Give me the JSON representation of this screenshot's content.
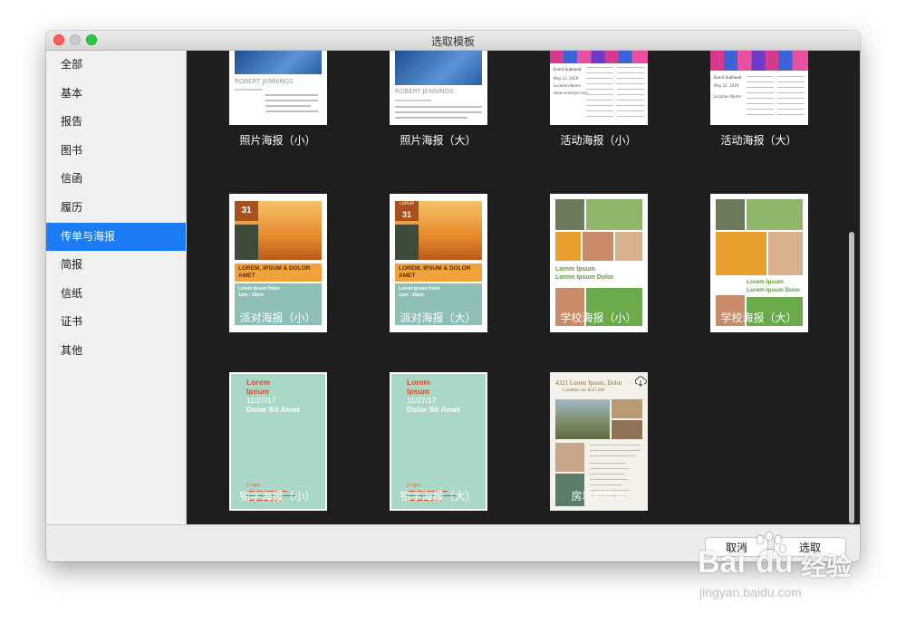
{
  "window": {
    "title": "选取模板"
  },
  "sidebar": {
    "items": [
      {
        "label": "全部"
      },
      {
        "label": "基本"
      },
      {
        "label": "报告"
      },
      {
        "label": "图书"
      },
      {
        "label": "信函"
      },
      {
        "label": "履历"
      },
      {
        "label": "传单与海报",
        "active": true
      },
      {
        "label": "简报"
      },
      {
        "label": "信纸"
      },
      {
        "label": "证书"
      },
      {
        "label": "其他"
      }
    ]
  },
  "templates": [
    {
      "label": "照片海报（小）",
      "text": {
        "name": "ROBERT JENNINGS"
      }
    },
    {
      "label": "照片海报（大）",
      "text": {
        "name": "ROBERT JENNINGS"
      }
    },
    {
      "label": "活动海报（小）",
      "text": {
        "heading": "Event Subhead",
        "date": "May 22, 2019",
        "loc": "Location Name",
        "site": "www.example.com"
      }
    },
    {
      "label": "活动海报（大）",
      "text": {
        "heading": "Event Subhead",
        "date": "May 22, 2019",
        "loc": "Location Name"
      }
    },
    {
      "label": "派对海报（小）",
      "text": {
        "num": "31",
        "main": "LOREM, IPSUM & DOLOR AMET",
        "sub": "Lorem Ipsum Dolor",
        "time": "1pm - 10pm"
      }
    },
    {
      "label": "派对海报（大）",
      "text": {
        "month": "LOREM",
        "num": "31",
        "main": "LOREM, IPSUM & DOLOR AMET",
        "sub": "Lorem Ipsum Dolor",
        "time": "1pm - 10pm"
      }
    },
    {
      "label": "学校海报（小）",
      "text": {
        "l1": "Lorem Ipsum",
        "l2": "Lorem Ipsum Dolor"
      }
    },
    {
      "label": "学校海报（大）",
      "text": {
        "l1": "Lorem Ipsum",
        "l2": "Lorem Ipsum Dolor"
      }
    },
    {
      "label": "铅字海报（小）",
      "text": {
        "l1": "Lorem",
        "l2": "Ipsum",
        "l3": "11/27/17",
        "l4": "Dolor Sit Amet",
        "l5": "5:15pm"
      }
    },
    {
      "label": "铅字海报（大）",
      "text": {
        "l1": "Lorem",
        "l2": "Ipsum",
        "l3": "11/27/17",
        "l4": "Dolor Sit Amet",
        "l5": "5:15pm"
      }
    },
    {
      "label": "房地产传单",
      "text": {
        "addr": "4321 Lorem Ipsum, Dolor",
        "price": "Curabitur leo $525,000"
      },
      "icon": "cloud-download-icon"
    }
  ],
  "buttons": {
    "cancel": "取消",
    "choose": "选取"
  },
  "watermark": {
    "brand": "Bai",
    "brand2": "du",
    "cn": "经验",
    "url": "jingyan.baidu.com"
  },
  "colors": {
    "accent": "#1b7cf5",
    "grid_bg": "#1e1e1e",
    "party_orange": "#f0a33a",
    "party_teal": "#8ebfb6",
    "school_green": "#6aaa4a",
    "type_mint": "#a9d8c6",
    "type_red": "#e04a2a"
  }
}
